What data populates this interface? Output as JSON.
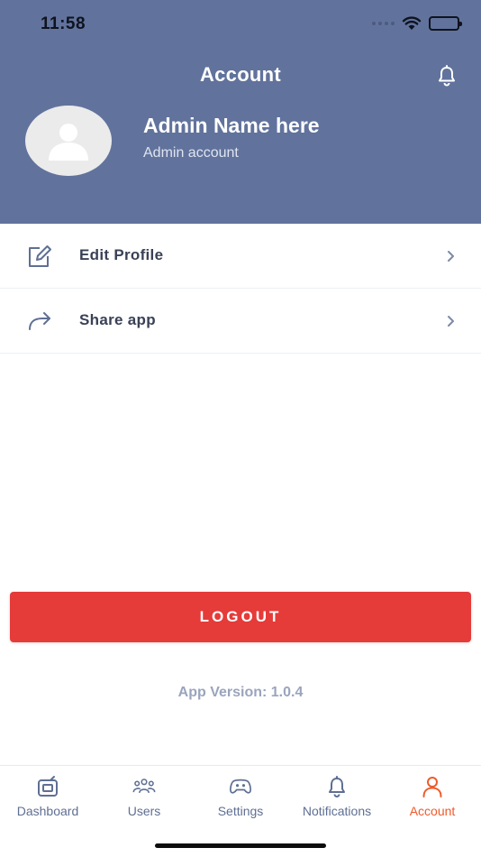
{
  "status_bar": {
    "time": "11:58"
  },
  "header": {
    "title": "Account",
    "admin_name": "Admin Name here",
    "admin_role": "Admin account"
  },
  "menu": [
    {
      "label": "Edit Profile",
      "icon": "edit-icon"
    },
    {
      "label": "Share app",
      "icon": "share-icon"
    }
  ],
  "logout_label": "LOGOUT",
  "app_version": "App Version: 1.0.4",
  "tabs": [
    {
      "label": "Dashboard",
      "icon": "dashboard-icon",
      "active": false
    },
    {
      "label": "Users",
      "icon": "users-icon",
      "active": false
    },
    {
      "label": "Settings",
      "icon": "gamepad-icon",
      "active": false
    },
    {
      "label": "Notifications",
      "icon": "bell-icon",
      "active": false
    },
    {
      "label": "Account",
      "icon": "person-icon",
      "active": true
    }
  ],
  "colors": {
    "header_bg": "#61739c",
    "logout_bg": "#e53b39",
    "active_tab": "#ef5a2a",
    "inactive_tab": "#5f6f93"
  }
}
